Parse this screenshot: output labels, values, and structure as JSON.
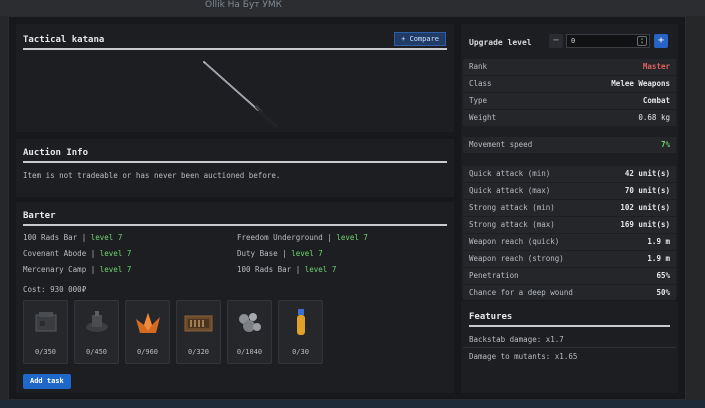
{
  "backdrop": {
    "chat_text": "Ollik На Бут УМК"
  },
  "item": {
    "name": "Tactical katana",
    "compare_label": "+ Compare"
  },
  "auction": {
    "title": "Auction Info",
    "text": "Item is not tradeable or has never been auctioned before."
  },
  "barter": {
    "title": "Barter",
    "traders": [
      {
        "name": "100 Rads Bar",
        "level": "level 7"
      },
      {
        "name": "Freedom Underground",
        "level": "level 7"
      },
      {
        "name": "Covenant Abode",
        "level": "level 7"
      },
      {
        "name": "Duty Base",
        "level": "level 7"
      },
      {
        "name": "Mercenary Camp",
        "level": "level 7"
      },
      {
        "name": "100 Rads Bar",
        "level": "level 7"
      }
    ],
    "separator": "|",
    "cost": "Cost: 930 000₽",
    "materials": [
      {
        "icon": "metal-box-icon",
        "qty": "0/350"
      },
      {
        "icon": "mechanism-part-icon",
        "qty": "0/450"
      },
      {
        "icon": "orange-crystal-icon",
        "qty": "0/960"
      },
      {
        "icon": "ammo-crate-icon",
        "qty": "0/320"
      },
      {
        "icon": "scrap-metal-icon",
        "qty": "0/1040"
      },
      {
        "icon": "vial-icon",
        "qty": "0/30"
      }
    ],
    "add_task_label": "Add task"
  },
  "stats": {
    "upgrade_label": "Upgrade level",
    "upgrade_value": "0",
    "minus": "−",
    "plus": "+",
    "rows": [
      {
        "k": "Rank",
        "v": "Master"
      },
      {
        "k": "Class",
        "v": "Melee Weapons"
      },
      {
        "k": "Type",
        "v": "Combat"
      },
      {
        "k": "Weight",
        "v": "0.68 kg"
      },
      {
        "k": "Movement speed",
        "v": "7%"
      },
      {
        "k": "Quick attack (min)",
        "v": "42 unit(s)"
      },
      {
        "k": "Quick attack (max)",
        "v": "70 unit(s)"
      },
      {
        "k": "Strong attack (min)",
        "v": "102 unit(s)"
      },
      {
        "k": "Strong attack (max)",
        "v": "169 unit(s)"
      },
      {
        "k": "Weapon reach (quick)",
        "v": "1.9 m"
      },
      {
        "k": "Weapon reach (strong)",
        "v": "1.9 m"
      },
      {
        "k": "Penetration",
        "v": "65%"
      },
      {
        "k": "Chance for a deep wound",
        "v": "50%"
      }
    ]
  },
  "features": {
    "title": "Features",
    "items": [
      "Backstab damage: x1.7",
      "Damage to mutants: x1.65"
    ]
  },
  "colors": {
    "rank": "#e0605e",
    "positive": "#6ed46e",
    "accent": "#1f67c9"
  }
}
